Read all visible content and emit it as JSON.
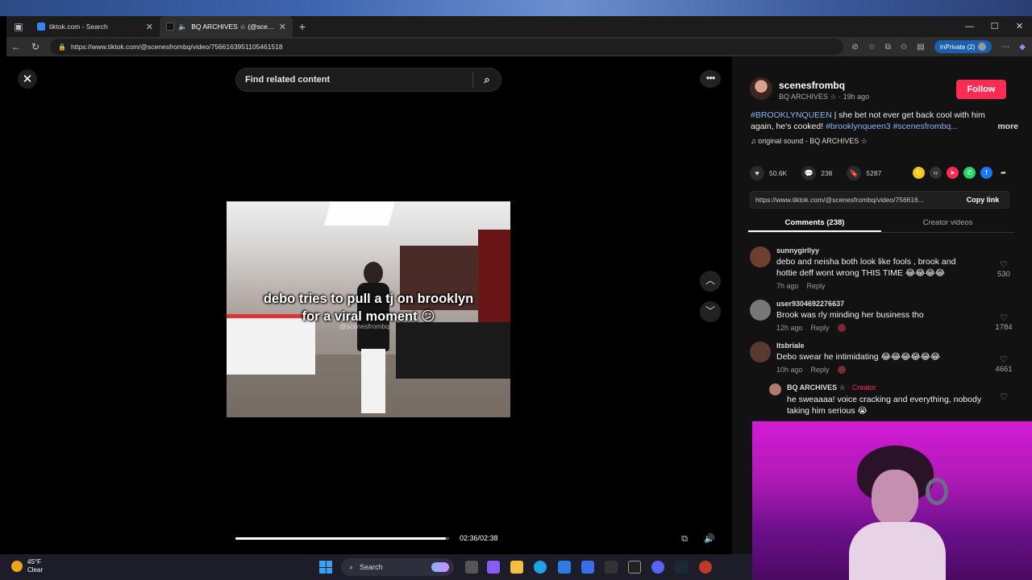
{
  "browser": {
    "tabs": [
      {
        "title": "tiktok.com - Search",
        "active": false
      },
      {
        "title": "BQ ARCHIVES ☆ (@scenesfromb",
        "active": true
      }
    ],
    "url": "https://www.tiktok.com/@scenesfrombq/video/7566163951105461518",
    "inprivate_label": "InPrivate (2)"
  },
  "viewer": {
    "search_placeholder": "Find related content",
    "video_caption_line1": "debo tries to pull a tj on brooklyn",
    "video_caption_line2": "for a viral moment 😕",
    "watermark": "@scenesfrombq",
    "time": "02:36/02:38",
    "progress_fraction": 0.985
  },
  "post": {
    "author_name": "scenesfrombq",
    "author_sub": "BQ ARCHIVES ☆ · 19h ago",
    "follow_label": "Follow",
    "desc_tag1": "#BROOKLYNQUEEN",
    "desc_text1": " | she bet not ever get back cool with him again, he's cooked! ",
    "desc_tag2": "#brooklynqueen3 #scenesfrombq...",
    "more_label": "more",
    "sound": "♫  original sound - BQ ARCHIVES ☆",
    "likes": "50.6K",
    "comments": "238",
    "saves": "5287",
    "link": "https://www.tiktok.com/@scenesfrombq/video/756616...",
    "copy_link_label": "Copy link",
    "tab_comments": "Comments (238)",
    "tab_creator": "Creator videos"
  },
  "comments": [
    {
      "user": "sunnygirllyy",
      "text": "debo and neisha both look like fools , brook and hottie deff wont wrong THIS TIME 😂😂😂😂",
      "time": "7h ago",
      "reply": "Reply",
      "likes": "530",
      "badge": false
    },
    {
      "user": "user9304692276637",
      "text": "Brook was rly minding her business tho",
      "time": "12h ago",
      "reply": "Reply",
      "likes": "1784",
      "badge": true
    },
    {
      "user": "ltsbriale",
      "text": "Debo swear he intimidating 😂😂😂😂😂😂",
      "time": "10h ago",
      "reply": "Reply",
      "likes": "4661",
      "badge": true
    },
    {
      "user": "BQ ARCHIVES ☆",
      "creator": "· Creator",
      "text": "he sweaaaa! voice cracking and everything, nobody taking him serious 😭",
      "likes": "",
      "badge": false
    }
  ],
  "taskbar": {
    "weather_temp": "45°F",
    "weather_cond": "Clear",
    "search_label": "Search"
  }
}
